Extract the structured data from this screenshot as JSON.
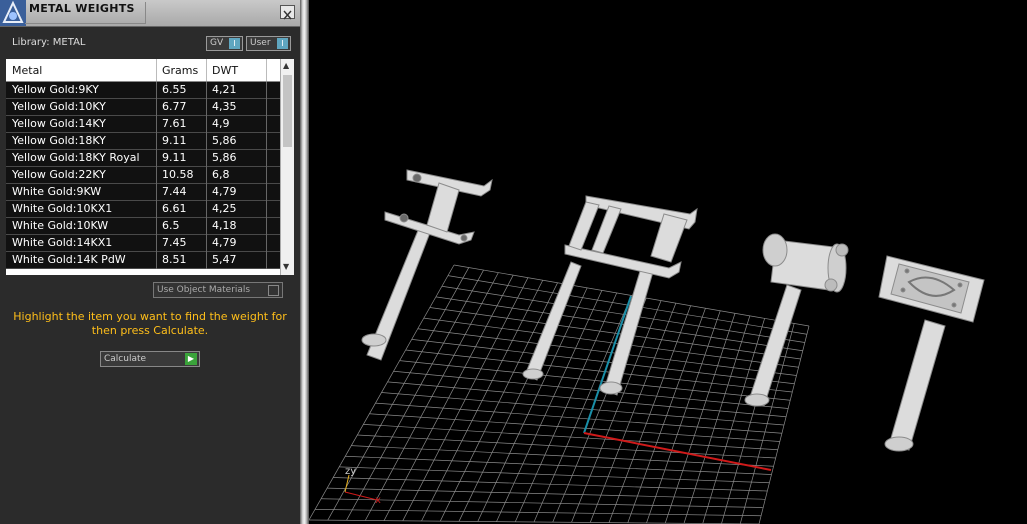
{
  "panel": {
    "title": "METAL WEIGHTS",
    "close_label": "X",
    "library_label": "Library: METAL",
    "toggles": [
      {
        "label": "GV",
        "check": "I"
      },
      {
        "label": "User",
        "check": "I"
      }
    ],
    "columns": [
      "Metal",
      "Grams",
      "DWT"
    ],
    "rows": [
      {
        "metal": "Yellow Gold:9KY",
        "grams": "6.55",
        "dwt": "4,21"
      },
      {
        "metal": "Yellow Gold:10KY",
        "grams": "6.77",
        "dwt": "4,35"
      },
      {
        "metal": "Yellow Gold:14KY",
        "grams": "7.61",
        "dwt": "4,9"
      },
      {
        "metal": "Yellow Gold:18KY",
        "grams": "9.11",
        "dwt": "5,86"
      },
      {
        "metal": "Yellow Gold:18KY Royal",
        "grams": "9.11",
        "dwt": "5,86"
      },
      {
        "metal": "Yellow Gold:22KY",
        "grams": "10.58",
        "dwt": "6,8"
      },
      {
        "metal": "White Gold:9KW",
        "grams": "7.44",
        "dwt": "4,79"
      },
      {
        "metal": "White Gold:10KX1",
        "grams": "6.61",
        "dwt": "4,25"
      },
      {
        "metal": "White Gold:10KW",
        "grams": "6.5",
        "dwt": "4,18"
      },
      {
        "metal": "White Gold:14KX1",
        "grams": "7.45",
        "dwt": "4,79"
      },
      {
        "metal": "White Gold:14K PdW",
        "grams": "8.51",
        "dwt": "5,47"
      }
    ],
    "use_object_materials_label": "Use Object Materials",
    "hint_text": "Highlight the item you want to find the weight for then press Calculate.",
    "calculate_label": "Calculate"
  },
  "viewport": {
    "axes_label": "zy"
  },
  "colors": {
    "accent_hint": "#ffbf1a",
    "x_axis": "#d01a1a",
    "y_axis": "#1a8fa8",
    "grid": "#8a8a8a"
  }
}
